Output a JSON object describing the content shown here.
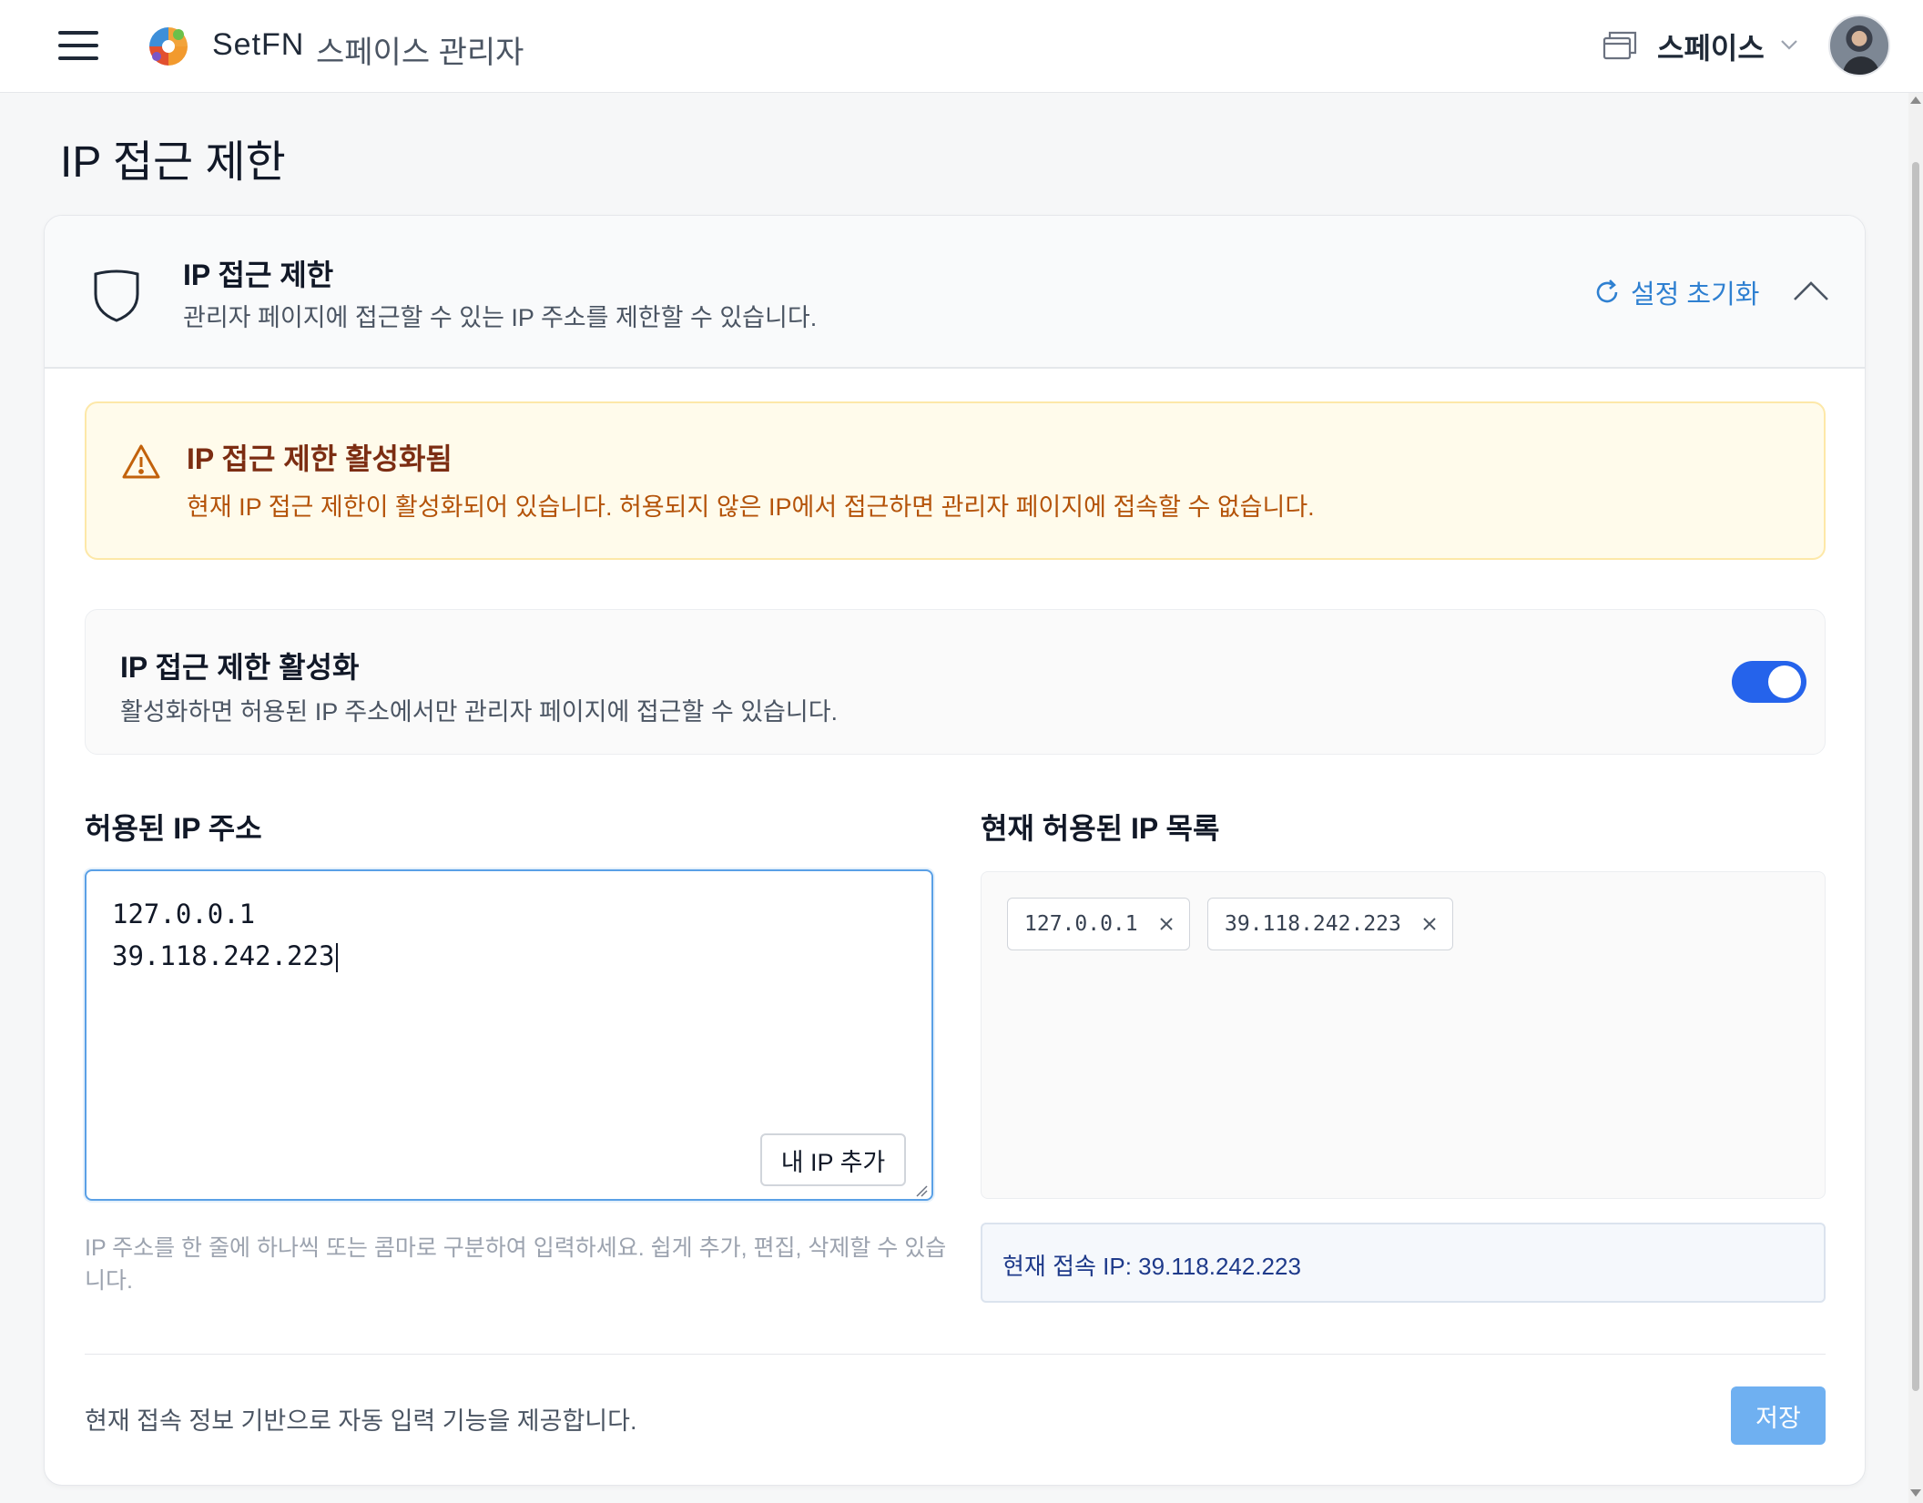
{
  "header": {
    "brand": "SetFN",
    "subtitle": "스페이스 관리자",
    "space_label": "스페이스"
  },
  "page": {
    "title": "IP 접근 제한"
  },
  "card": {
    "title": "IP 접근 제한",
    "description": "관리자 페이지에 접근할 수 있는 IP 주소를 제한할 수 있습니다.",
    "reset_label": "설정 초기화"
  },
  "warning": {
    "title": "IP 접근 제한 활성화됨",
    "text": "현재 IP 접근 제한이 활성화되어 있습니다. 허용되지 않은 IP에서 접근하면 관리자 페이지에 접속할 수 없습니다."
  },
  "toggle": {
    "title": "IP 접근 제한 활성화",
    "description": "활성화하면 허용된 IP 주소에서만 관리자 페이지에 접근할 수 있습니다.",
    "enabled": true
  },
  "allowed": {
    "label": "허용된 IP 주소",
    "lines": [
      "127.0.0.1",
      "39.118.242.223"
    ],
    "add_my_ip_label": "내 IP 추가",
    "hint": "IP 주소를 한 줄에 하나씩 또는 콤마로 구분하여 입력하세요. 쉽게 추가, 편집, 삭제할 수 있습니다."
  },
  "current_list": {
    "label": "현재 허용된 IP 목록",
    "chips": [
      "127.0.0.1",
      "39.118.242.223"
    ],
    "current_ip_text": "현재 접속 IP: 39.118.242.223"
  },
  "footer": {
    "text": "현재 접속 정보 기반으로 자동 입력 기능을 제공합니다.",
    "save_label": "저장"
  },
  "colors": {
    "accent": "#2563eb",
    "link": "#2f80d1",
    "warning_bg": "#fffbeb",
    "warning_title": "#7c2d12",
    "warning_text": "#b45309",
    "save_button": "#6fb0f1"
  },
  "icons": {
    "menu": "hamburger-icon",
    "logo": "setfn-logo",
    "space": "window-stack-icon",
    "chevron": "chevron-down-icon",
    "shield": "shield-icon",
    "reset": "refresh-icon",
    "collapse": "chevron-up-icon",
    "warning": "warning-triangle-icon",
    "chip_remove": "close-icon"
  }
}
